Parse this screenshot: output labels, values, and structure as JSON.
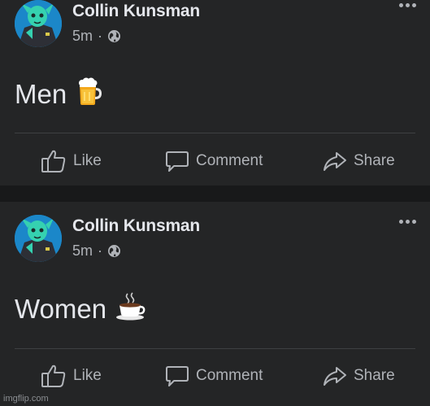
{
  "posts": [
    {
      "author": "Collin Kunsman",
      "time": "5m",
      "separator": "·",
      "privacy_icon": "globe-icon",
      "text": "Men",
      "emoji": "beer-mug-icon",
      "actions": {
        "like": "Like",
        "comment": "Comment",
        "share": "Share"
      }
    },
    {
      "author": "Collin Kunsman",
      "time": "5m",
      "separator": "·",
      "privacy_icon": "globe-icon",
      "text": "Women",
      "emoji": "coffee-cup-icon",
      "actions": {
        "like": "Like",
        "comment": "Comment",
        "share": "Share"
      }
    }
  ],
  "watermark": "imgflip.com",
  "colors": {
    "background": "#18191a",
    "card": "#242526",
    "primary_text": "#e4e6eb",
    "secondary_text": "#b0b3b8",
    "divider": "#3e4042"
  }
}
